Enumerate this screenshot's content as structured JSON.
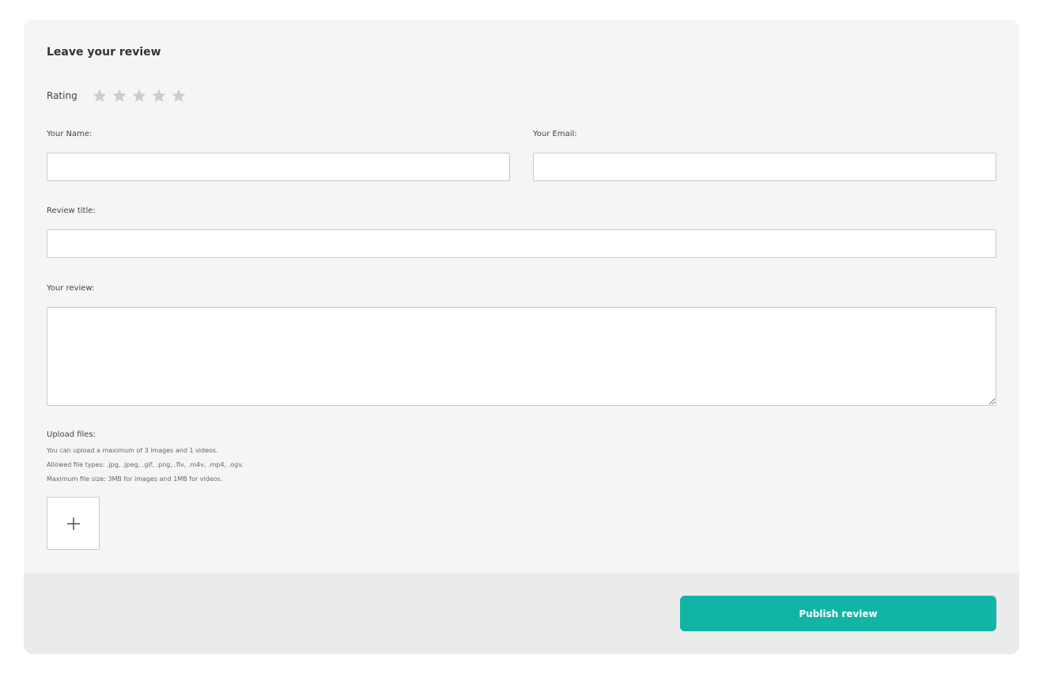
{
  "form": {
    "title": "Leave your review",
    "rating": {
      "label": "Rating",
      "value": 0,
      "max": 5,
      "star_color": "#cccccc"
    },
    "name": {
      "label": "Your Name:",
      "value": "",
      "placeholder": ""
    },
    "email": {
      "label": "Your Email:",
      "value": "",
      "placeholder": ""
    },
    "review_title": {
      "label": "Review title:",
      "value": "",
      "placeholder": ""
    },
    "review_body": {
      "label": "Your review:",
      "value": "",
      "placeholder": ""
    },
    "upload": {
      "label": "Upload files:",
      "hints": [
        "You can upload a maximum of 3 images and 1 videos.",
        "Allowed file types: .jpg, .jpeg, .gif, .png, .flv, .m4v, .mp4, .ogv.",
        "Maximum file size: 3MB for images and 1MB for videos."
      ],
      "add_icon": "plus-icon"
    }
  },
  "footer": {
    "publish_label": "Publish review",
    "accent_color": "#12b5a5"
  }
}
